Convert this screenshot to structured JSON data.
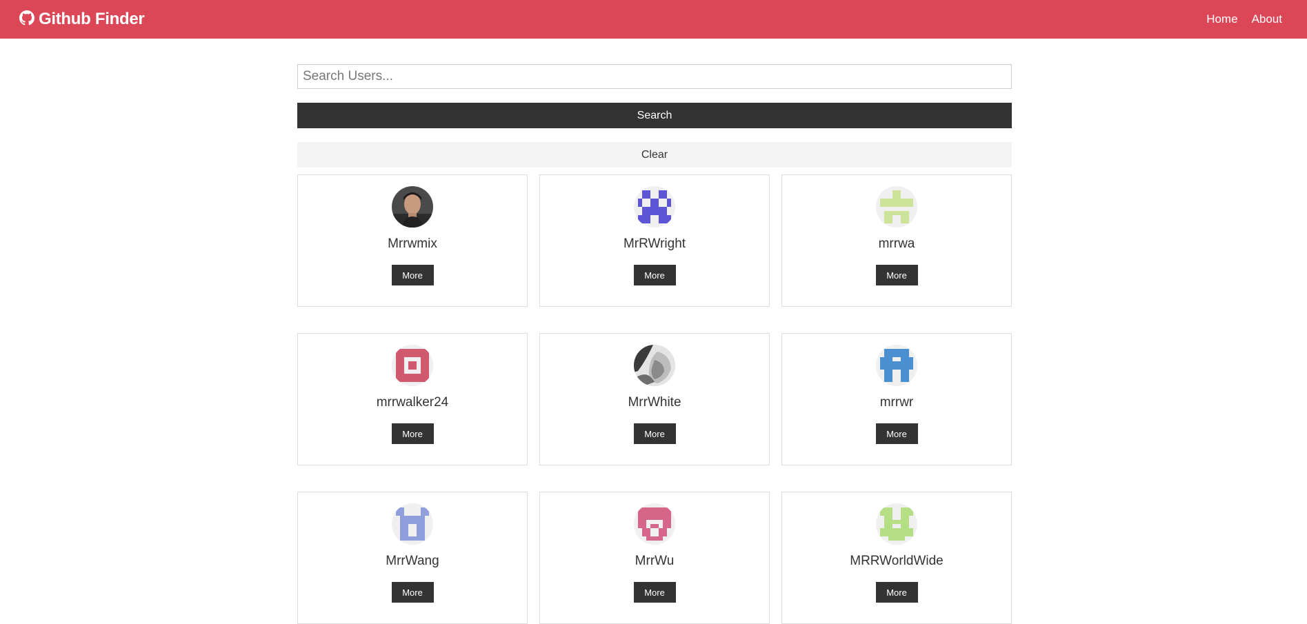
{
  "navbar": {
    "brand_icon": "github-icon",
    "title": "Github Finder",
    "links": [
      {
        "label": "Home"
      },
      {
        "label": "About"
      }
    ],
    "background_color": "#dc4757"
  },
  "search": {
    "placeholder": "Search Users...",
    "value": "",
    "search_button_label": "Search",
    "clear_button_label": "Clear"
  },
  "users": [
    {
      "login": "Mrrwmix",
      "more_label": "More",
      "avatar": "photo-man-avatar"
    },
    {
      "login": "MrRWright",
      "more_label": "More",
      "avatar": "identicon-purple",
      "color": "#5c55d6"
    },
    {
      "login": "mrrwa",
      "more_label": "More",
      "avatar": "identicon-lightgreen",
      "color": "#cde39a"
    },
    {
      "login": "mrrwalker24",
      "more_label": "More",
      "avatar": "identicon-crimson",
      "color": "#d0596e"
    },
    {
      "login": "MrrWhite",
      "more_label": "More",
      "avatar": "photo-grayscale-avatar"
    },
    {
      "login": "mrrwr",
      "more_label": "More",
      "avatar": "identicon-blue",
      "color": "#4a8fd0"
    },
    {
      "login": "MrrWang",
      "more_label": "More",
      "avatar": "identicon-lavender",
      "color": "#8e9fdc"
    },
    {
      "login": "MrrWu",
      "more_label": "More",
      "avatar": "identicon-pink",
      "color": "#d6658a"
    },
    {
      "login": "MRRWorldWide",
      "more_label": "More",
      "avatar": "identicon-green",
      "color": "#b5de85"
    }
  ]
}
